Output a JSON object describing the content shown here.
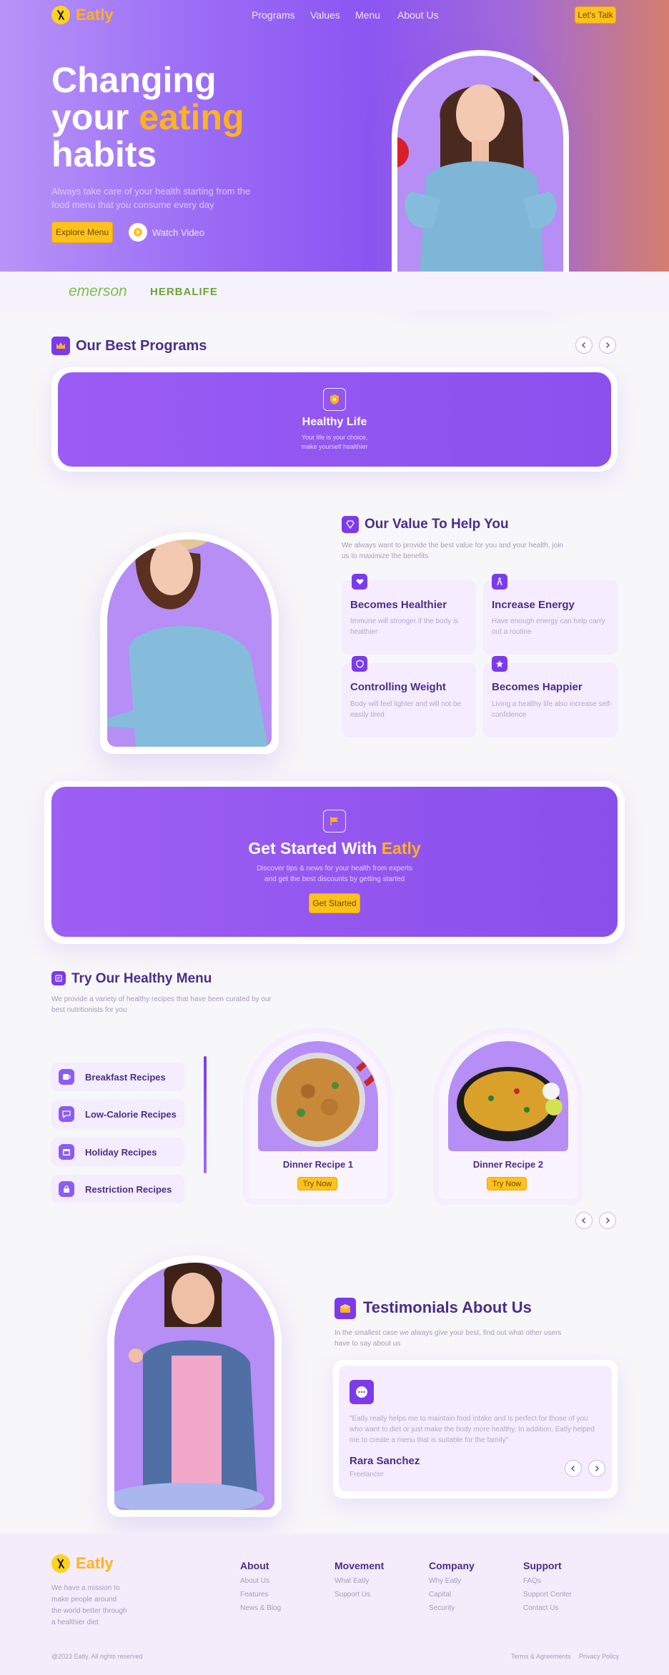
{
  "brand": {
    "name": "Eatly"
  },
  "nav": {
    "items": [
      "Programs",
      "Values",
      "Menu",
      "About Us"
    ],
    "cta": "Let's Talk"
  },
  "hero": {
    "title_line1": "Changing",
    "title_your": "your",
    "title_accent": "eating",
    "title_line3": "habits",
    "subtitle": "Always take care of your health starting from the food menu that you consume every day",
    "primary_button": "Explore Menu",
    "watch_label": "Watch Video"
  },
  "partners": [
    "emerson",
    "HERBALIFE"
  ],
  "programs": {
    "heading": "Our Best Programs",
    "card_title": "Healthy Life",
    "card_text": "Your life is your choice, make yourself healthier"
  },
  "value": {
    "heading": "Our Value To Help You",
    "subtitle": "We always want to provide the best value for you and your health, join us to maximize the benefits",
    "cards": [
      {
        "title": "Becomes Healthier",
        "text": "Immune will stronger if the body is healthier",
        "icon": "heart-icon"
      },
      {
        "title": "Increase Energy",
        "text": "Have enough energy can help carry out a routine",
        "icon": "energy-icon"
      },
      {
        "title": "Controlling Weight",
        "text": "Body will feel lighter and will not be easily tired",
        "icon": "shield-icon"
      },
      {
        "title": "Becomes Happier",
        "text": "Living a healthy life also increase self-confidence",
        "icon": "star-icon"
      }
    ]
  },
  "get_started": {
    "title_prefix": "Get Started With",
    "title_accent": "Eatly",
    "subtitle": "Discover tips & news for your health from experts and get the best discounts by getting started",
    "button": "Get Started"
  },
  "menu": {
    "heading": "Try Our Healthy Menu",
    "subtitle": "We provide a variety of healthy recipes that have been curated by our best nutritionists for you",
    "categories": [
      "Breakfast Recipes",
      "Low-Calorie Recipes",
      "Holiday Recipes",
      "Restriction Recipes"
    ],
    "recipes": [
      {
        "title": "Dinner Recipe 1",
        "button": "Try Now"
      },
      {
        "title": "Dinner Recipe 2",
        "button": "Try Now"
      }
    ]
  },
  "testimonials": {
    "heading": "Testimonials About Us",
    "subtitle": "In the smallest case we always give your best, find out what other users have to say about us",
    "quote": "\"Eatly really helps me to maintain food intake and is perfect for those of you who want to diet or just make the body more healthy. In addition, Eatly helped me to create a menu that is suitable for the family\"",
    "name": "Rara Sanchez",
    "role": "Freelancer"
  },
  "footer": {
    "tagline": "We have a mission to make people around the world better through a healthier diet",
    "columns": [
      {
        "title": "About",
        "links": [
          "About Us",
          "Features",
          "News & Blog"
        ]
      },
      {
        "title": "Movement",
        "links": [
          "What Eatly",
          "Support Us"
        ]
      },
      {
        "title": "Company",
        "links": [
          "Why Eatly",
          "Capital",
          "Security"
        ]
      },
      {
        "title": "Support",
        "links": [
          "FAQs",
          "Support Center",
          "Contact Us"
        ]
      }
    ],
    "copyright": "@2023 Eatly. All rights reserved",
    "legal": [
      "Terms & Agreements",
      "Privacy Policy"
    ]
  },
  "colors": {
    "primary": "#8b55f2",
    "accent": "#ffb21e",
    "heading": "#4b2e8a"
  }
}
